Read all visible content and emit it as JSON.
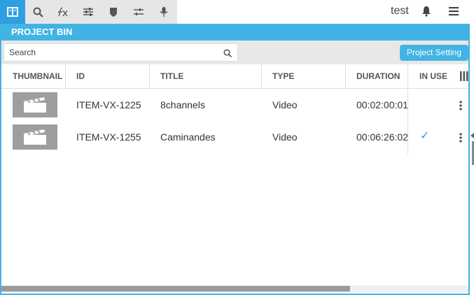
{
  "toolbar": {
    "icons": [
      "panel-icon",
      "search-icon",
      "effects-icon",
      "sliders-icon",
      "shield-icon",
      "adjust-icon",
      "microphone-icon"
    ],
    "active_color": "#2d9fe2"
  },
  "header": {
    "user": "test",
    "bell_icon": "bell-icon",
    "menu_icon": "hamburger-menu-icon"
  },
  "panel": {
    "title": "PROJECT BIN",
    "accent": "#42b3e5",
    "search_placeholder": "Search",
    "search_value": "",
    "project_setting_label": "Project Setting"
  },
  "table": {
    "columns": [
      "THUMBNAIL",
      "ID",
      "TITLE",
      "TYPE",
      "DURATION",
      "IN USE"
    ],
    "rows": [
      {
        "id": "ITEM-VX-1225",
        "title": "8channels",
        "type": "Video",
        "duration": "00:02:00:01",
        "in_use": false
      },
      {
        "id": "ITEM-VX-1255",
        "title": "Caminandes",
        "type": "Video",
        "duration": "00:06:26:02",
        "in_use": true
      }
    ],
    "check_glyph": "✓"
  },
  "scrollbar": {
    "position_fraction": 0.0,
    "visible_fraction": 0.75
  }
}
